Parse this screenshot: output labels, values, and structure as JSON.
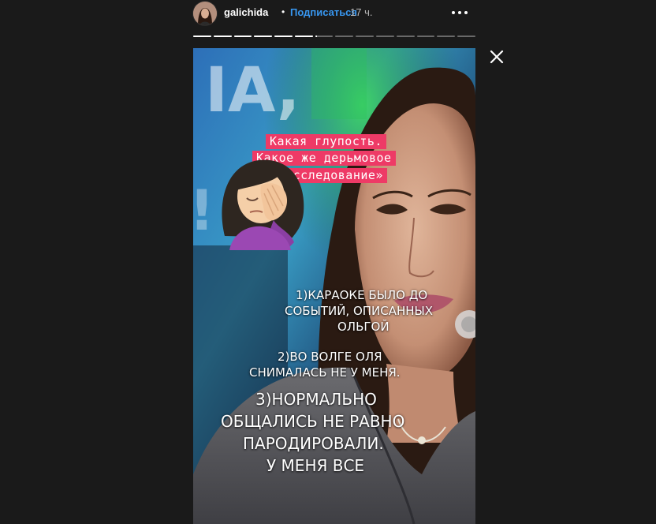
{
  "header": {
    "username": "galichida",
    "separator": "•",
    "follow_label": "Подписаться",
    "time_ago": "17 ч."
  },
  "progress": {
    "segments_total": 14,
    "segments_complete": 6,
    "current_segment_fraction": 0.1
  },
  "story": {
    "caption_lines": [
      "Какая глупость.",
      "Какое же дерьмовое",
      "«расследование»"
    ],
    "point1_lines": [
      "1)КАРАОКЕ БЫЛО ДО",
      "СОБЫТИЙ, ОПИСАННЫХ",
      "ОЛЬГОЙ"
    ],
    "point2_lines": [
      "2)ВО ВОЛГЕ ОЛЯ",
      "СНИМАЛАСЬ НЕ У МЕНЯ."
    ],
    "point3_lines": [
      "3)НОРМАЛЬНО",
      "ОБЩАЛИСЬ НЕ РАВНО",
      "ПАРОДИРОВАЛИ.",
      "У МЕНЯ ВСЕ"
    ],
    "emoji": "woman-facepalming-icon"
  },
  "colors": {
    "background": "#1a1a1a",
    "follow_link": "#3897f0",
    "caption_highlight": "#ee3a66",
    "text": "#ffffff"
  }
}
